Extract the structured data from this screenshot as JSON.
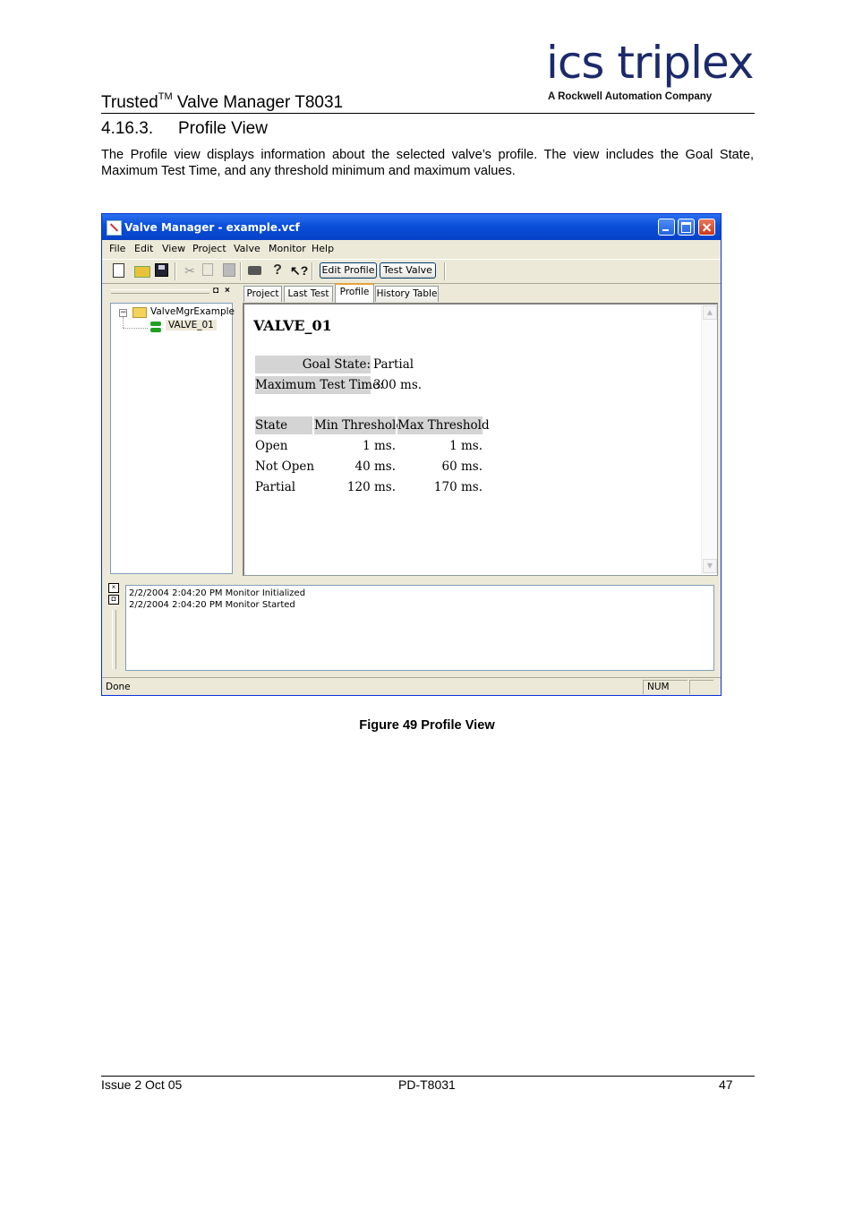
{
  "header": {
    "logo_text": "ics triplex",
    "logo_sub": "A Rockwell Automation Company",
    "doc_title": "Trusted",
    "doc_title_sup": "TM",
    "doc_title_rest": " Valve Manager T8031"
  },
  "section": {
    "number": "4.16.3.",
    "title": "Profile View"
  },
  "paragraph": "The Profile view displays information about the selected valve’s profile.  The view includes the Goal State, Maximum Test Time, and any threshold minimum and maximum values.",
  "window": {
    "title": "Valve Manager - example.vcf",
    "menu": [
      "File",
      "Edit",
      "View",
      "Project",
      "Valve",
      "Monitor",
      "Help"
    ],
    "toolbar_buttons": {
      "edit_profile": "Edit Profile",
      "test_valve": "Test Valve"
    },
    "tree": {
      "root": "ValveMgrExample",
      "child": "VALVE_01",
      "expander": "−"
    },
    "pane_controls": {
      "float": "◘",
      "close": "×"
    },
    "tabs": [
      "Project",
      "Last Test",
      "Profile",
      "History Table"
    ],
    "active_tab": "Profile",
    "profile": {
      "valve_name": "VALVE_01",
      "goal_state_label": "Goal State:",
      "goal_state": "Partial",
      "max_test_time_label": "Maximum Test Time:",
      "max_test_time": "300 ms.",
      "columns": [
        "State",
        "Min Threshold",
        "Max Threshold"
      ],
      "rows": [
        [
          "Open",
          "1 ms.",
          "1 ms."
        ],
        [
          "Not Open",
          "40 ms.",
          "60 ms."
        ],
        [
          "Partial",
          "120 ms.",
          "170 ms."
        ]
      ]
    },
    "log": [
      "2/2/2004 2:04:20 PM Monitor Initialized",
      "2/2/2004 2:04:20 PM Monitor Started"
    ],
    "status": {
      "text": "Done",
      "num": "NUM"
    }
  },
  "caption": "Figure 49 Profile View",
  "footer": {
    "left": "Issue 2 Oct 05",
    "center": "PD-T8031",
    "right": "47"
  }
}
